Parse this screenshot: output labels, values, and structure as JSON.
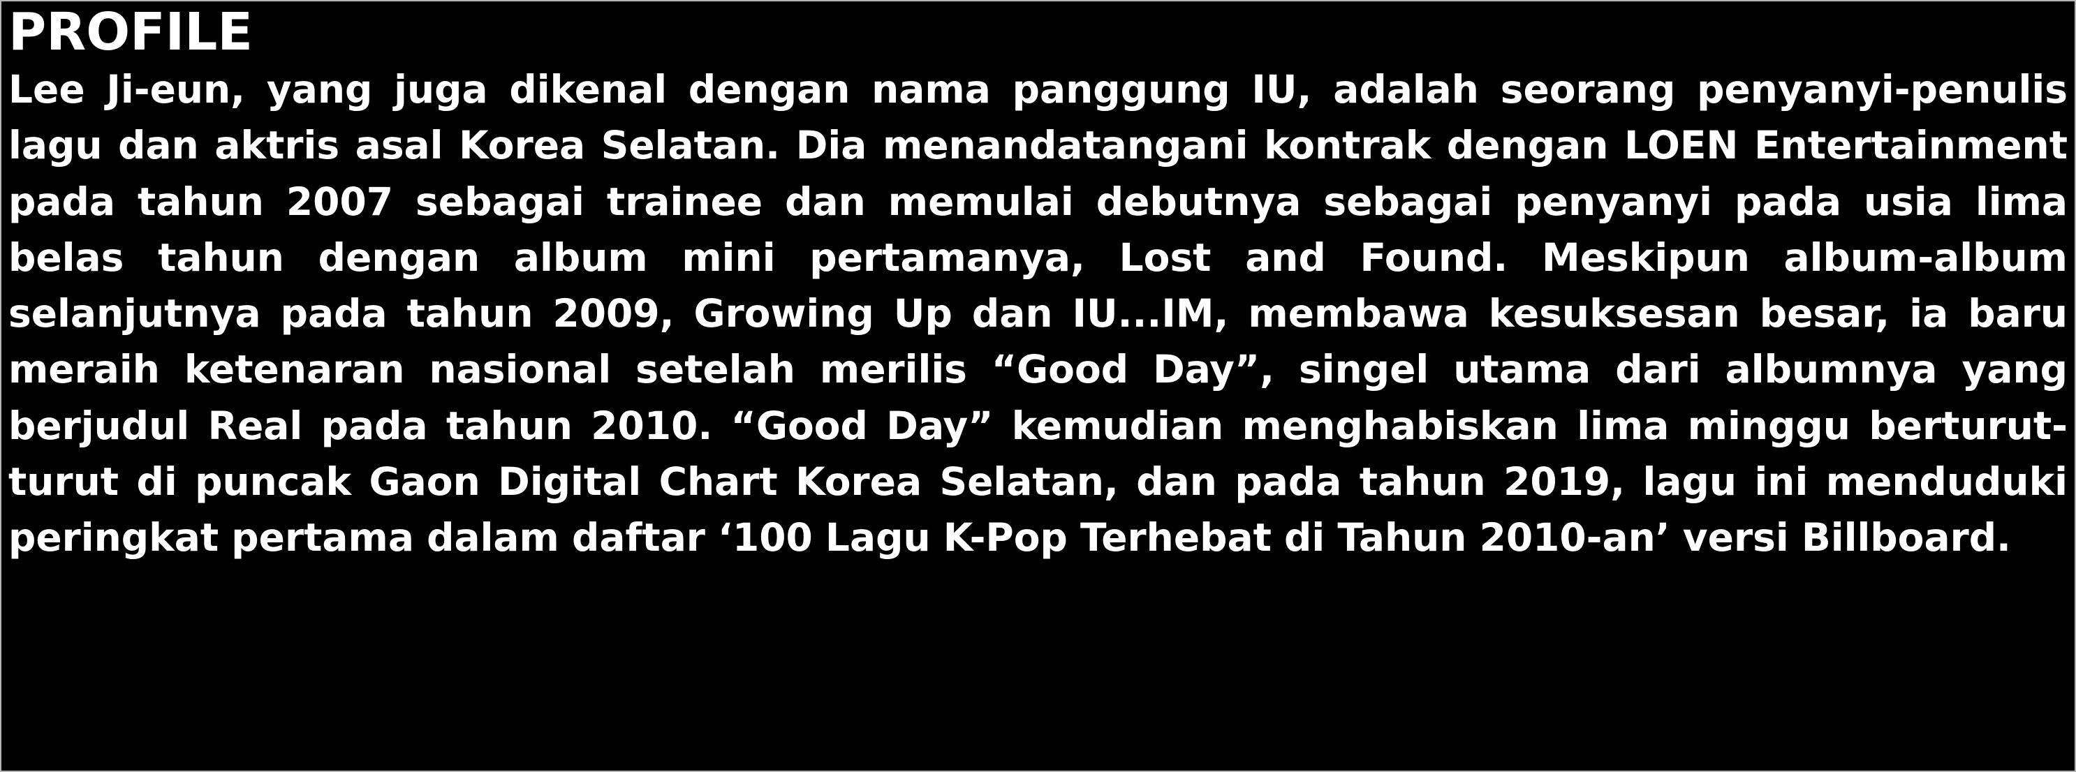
{
  "profile": {
    "heading": "PROFILE",
    "body": "Lee Ji-eun, yang juga dikenal dengan nama panggung IU, adalah seorang penyanyi-penulis lagu dan aktris asal Korea Selatan. Dia menandatangani kontrak dengan LOEN Entertainment pada tahun 2007 sebagai trainee dan memulai debutnya sebagai penyanyi pada usia lima belas tahun dengan album mini pertamanya, Lost and Found. Meskipun album-album selanjutnya pada tahun 2009, Growing Up dan IU...IM, membawa kesuksesan besar, ia baru meraih ketenaran nasional setelah merilis “Good Day”, singel utama dari albumnya yang berjudul Real pada tahun 2010. “Good Day” kemudian menghabiskan lima minggu berturut-turut di puncak Gaon Digital Chart Korea Selatan, dan pada tahun 2019, lagu ini menduduki peringkat pertama dalam daftar ‘100 Lagu K-Pop Terhebat di Tahun 2010-an’ versi Billboard."
  }
}
